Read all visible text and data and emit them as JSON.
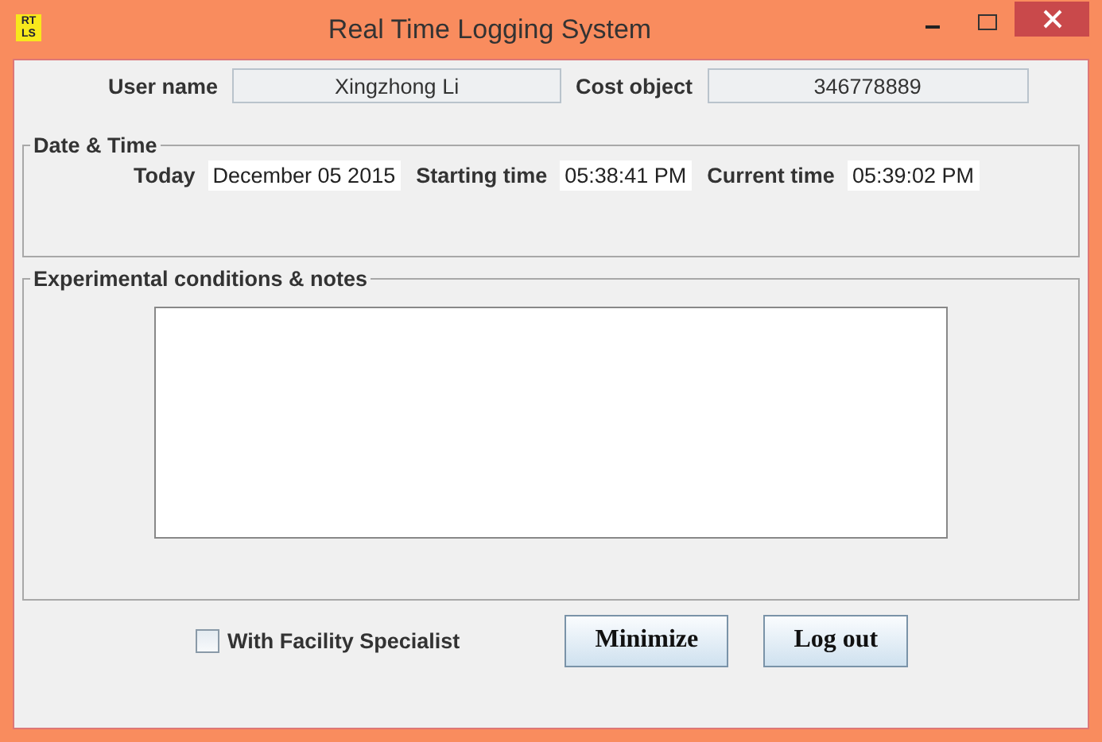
{
  "window": {
    "title": "Real Time Logging System",
    "logo": [
      "RT",
      "LS"
    ]
  },
  "user": {
    "label": "User name",
    "value": "Xingzhong Li"
  },
  "cost": {
    "label": "Cost object",
    "value": "346778889"
  },
  "date_time": {
    "title": "Date & Time",
    "fields": [
      {
        "label": "Today",
        "value": "December 05 2015"
      },
      {
        "label": "Starting time",
        "value": "05:38:41 PM"
      },
      {
        "label": "Current time",
        "value": "05:39:02 PM"
      }
    ]
  },
  "notes": {
    "title": "Experimental conditions & notes"
  },
  "checkbox": {
    "label": "With Facility Specialist",
    "checked": false
  },
  "buttons": [
    "Minimize",
    "Log out"
  ]
}
